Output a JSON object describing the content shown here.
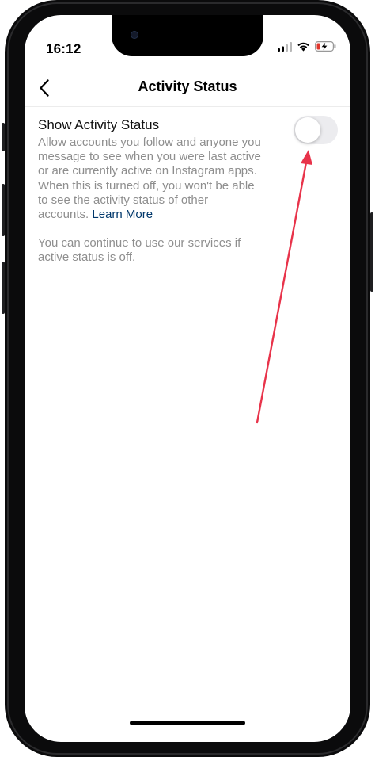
{
  "status_bar": {
    "time": "16:12",
    "icons": [
      "cellular-signal-icon",
      "wifi-icon",
      "battery-low-charging-icon"
    ]
  },
  "nav": {
    "title": "Activity Status",
    "back_icon": "chevron-left-icon"
  },
  "setting": {
    "title": "Show Activity Status",
    "description_lines": [
      "Allow accounts you follow and anyone you",
      "message to see when you were last active",
      "or are currently active on Instagram apps.",
      "When this is turned off, you won't be able",
      "to see the activity status of other",
      "accounts."
    ],
    "link_label": "Learn More",
    "toggle_on": false
  },
  "note_lines": [
    "You can continue to use our services if",
    "active status is off."
  ],
  "colors": {
    "text_primary": "#111111",
    "text_secondary": "#8e8e8e",
    "link": "#00376b",
    "toggle_track_off": "#ececef",
    "battery_low": "#e0362c",
    "annotation_arrow": "#e8334a"
  }
}
